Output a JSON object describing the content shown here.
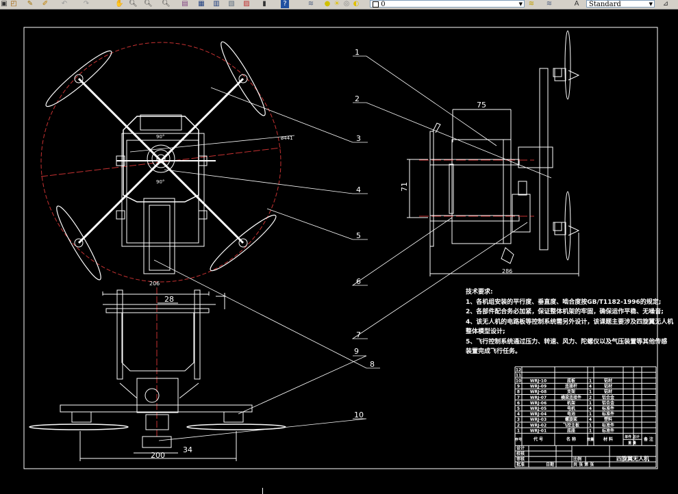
{
  "toolbar": {
    "layer_value": "0",
    "text_style_value": "Standard",
    "icons": [
      "open-icon",
      "save-icon",
      "brush-icon",
      "match-properties-icon",
      "undo-icon",
      "redo-icon",
      "pan-icon",
      "zoom-realtime-icon",
      "zoom-window-icon",
      "zoom-previous-icon",
      "properties-icon",
      "design-center-icon",
      "tool-palette-icon",
      "sheet-set-icon",
      "markup-icon",
      "calculator-icon",
      "help-icon",
      "layer-manager-icon",
      "layer-state-icon",
      "make-current-icon",
      "layer-previous-icon",
      "text-style-icon",
      "dimension-style-icon"
    ]
  },
  "drawing": {
    "colors": {
      "background": "#000000",
      "lines": "#ffffff",
      "centerline": "#c83232"
    },
    "dimensions": {
      "side_width": "75",
      "side_height": "71",
      "side_length": "286",
      "front_width": "206",
      "front_offset": "28",
      "front_span": "200",
      "front_base": "34",
      "rotor_circle": "ø441",
      "angle_top": "90°",
      "angle_bottom": "90°"
    },
    "balloons": [
      "1",
      "2",
      "3",
      "4",
      "5",
      "6",
      "7",
      "8",
      "9",
      "10"
    ]
  },
  "notes": {
    "title": "技术要求:",
    "lines": [
      "1、各机组安装的平行度、垂直度、啮合度按GB/T1182-1996的规定;",
      "2、各部件配合务必加紧，保证整体机架的牢固，确保运作平稳、无噪音;",
      "4、该无人机的电路板等控制系统需另外设计，该课题主要涉及四旋翼无人机",
      "整体模型设计;",
      "5、飞行控制系统通过压力、转速、风力、陀螺仪以及气压装置等其他传感",
      "装置完成飞行任务。"
    ]
  },
  "parts_list": {
    "rows": [
      {
        "no": "12",
        "code": "",
        "name": "",
        "qty": "",
        "material": ""
      },
      {
        "no": "11",
        "code": "",
        "name": "",
        "qty": "",
        "material": ""
      },
      {
        "no": "10",
        "code": "WRJ-10",
        "name": "底板",
        "qty": "1",
        "material": "铝材"
      },
      {
        "no": "9",
        "code": "WRJ-09",
        "name": "连接杆",
        "qty": "4",
        "material": "铝材"
      },
      {
        "no": "8",
        "code": "WRJ-08",
        "name": "支架",
        "qty": "1",
        "material": "铝材"
      },
      {
        "no": "7",
        "code": "WRJ-07",
        "name": "横梁连接件",
        "qty": "2",
        "material": "铝合金"
      },
      {
        "no": "6",
        "code": "WRJ-06",
        "name": "机架",
        "qty": "1",
        "material": "铝合金"
      },
      {
        "no": "5",
        "code": "WRJ-05",
        "name": "电机",
        "qty": "4",
        "material": "标准件"
      },
      {
        "no": "4",
        "code": "WRJ-04",
        "name": "电池",
        "qty": "1",
        "material": "标准件"
      },
      {
        "no": "3",
        "code": "WRJ-03",
        "name": "螺旋桨",
        "qty": "4",
        "material": "塑料"
      },
      {
        "no": "2",
        "code": "WRJ-02",
        "name": "飞控主板",
        "qty": "1",
        "material": "标准件"
      },
      {
        "no": "1",
        "code": "WRJ-01",
        "name": "底座",
        "qty": "1",
        "material": "标准件"
      }
    ],
    "header": {
      "no": "序号",
      "code": "代 号",
      "name": "名 称",
      "qty": "数量",
      "material": "材 料",
      "unit_weight": "单件 总计",
      "weight": "重 量",
      "remark": "备 注"
    }
  },
  "title_block": {
    "design": "设计",
    "check": "校核",
    "review": "审核",
    "approve": "批准",
    "scale": "比例",
    "date": "日期",
    "sheets": "共 张 第 张",
    "title": "四旋翼无人机"
  }
}
